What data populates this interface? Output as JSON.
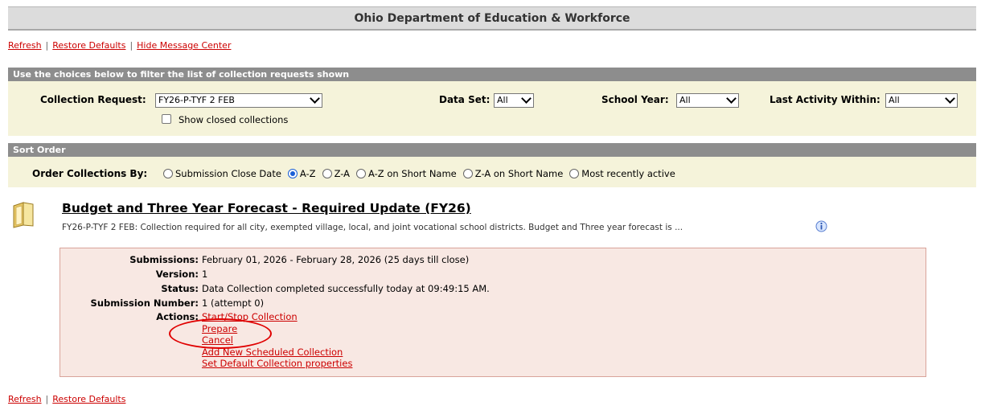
{
  "banner": {
    "title": "Ohio Department of Education & Workforce"
  },
  "top_links": {
    "refresh": "Refresh",
    "restore": "Restore Defaults",
    "hide": "Hide Message Center"
  },
  "filter": {
    "header": "Use the choices below to filter the list of collection requests shown",
    "collection_label": "Collection Request:",
    "collection_value": "FY26-P-TYF 2 FEB",
    "dataset_label": "Data Set:",
    "dataset_value": "All",
    "year_label": "School Year:",
    "year_value": "All",
    "activity_label": "Last Activity Within:",
    "activity_value": "All",
    "closed_label": "Show closed collections"
  },
  "sort": {
    "header": "Sort Order",
    "label": "Order Collections By:",
    "options": [
      "Submission Close Date",
      "A-Z",
      "Z-A",
      "A-Z on Short Name",
      "Z-A on Short Name",
      "Most recently active"
    ],
    "selected": "A-Z"
  },
  "collection": {
    "title": "Budget and Three Year Forecast - Required Update (FY26)",
    "description": "FY26-P-TYF 2 FEB: Collection required for all city, exempted village, local, and joint vocational school districts. Budget and Three year forecast is ...",
    "submissions_label": "Submissions:",
    "submissions_value": "February 01, 2026 - February 28, 2026 (25 days till close)",
    "version_label": "Version:",
    "version_value": "1",
    "status_label": "Status:",
    "status_value": "Data Collection completed successfully today at 09:49:15 AM.",
    "number_label": "Submission Number:",
    "number_value": "1 (attempt 0)",
    "actions_label": "Actions:",
    "actions": [
      "Start/Stop Collection",
      "Prepare",
      "Cancel",
      "Add New Scheduled Collection",
      "Set Default Collection properties"
    ],
    "highlight_color": "#e00000"
  },
  "bottom_links": {
    "refresh": "Refresh",
    "restore": "Restore Defaults"
  }
}
